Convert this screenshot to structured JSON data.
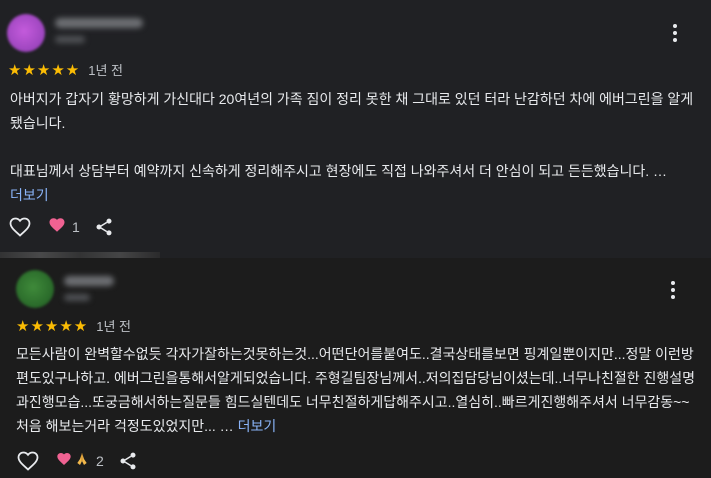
{
  "reviews": [
    {
      "stars": "★★★★★",
      "time": "1년 전",
      "text_p1": "아버지가 갑자기 황망하게 가신대다 20여년의 가족 짐이 정리 못한 채 그대로 있던 터라 난감하던 차에 에버그린을 알게 됐습니다.",
      "text_p2": "대표님께서 상담부터 예약까지 신속하게 정리해주시고 현장에도 직접 나와주셔서 더 안심이 되고 든든했습니다. …",
      "more_label": "더보기",
      "reaction_count": "1",
      "reactions": [
        "heart"
      ]
    },
    {
      "stars": "★★★★★",
      "time": "1년 전",
      "text_p1": "모든사람이 완벽할수없듯 각자가잘하는것못하는것...어떤단어를붙여도..결국상태를보면 핑계일뿐이지만...정말 이런방편도있구나하고. 에버그린을통해서알게되었습니다. 주형길팀장님께서..저의집담당님이셨는데..너무나친절한 진행설명과진행모습...또궁금해서하는질문들 힘드실텐데도 너무친절하게답해주시고..열심히..빠르게진행해주셔서 너무감동~~처음 해보는거라 걱정도있었지만... …",
      "more_label": "더보기",
      "reaction_count": "2",
      "reactions": [
        "heart",
        "praying-hands"
      ]
    }
  ]
}
